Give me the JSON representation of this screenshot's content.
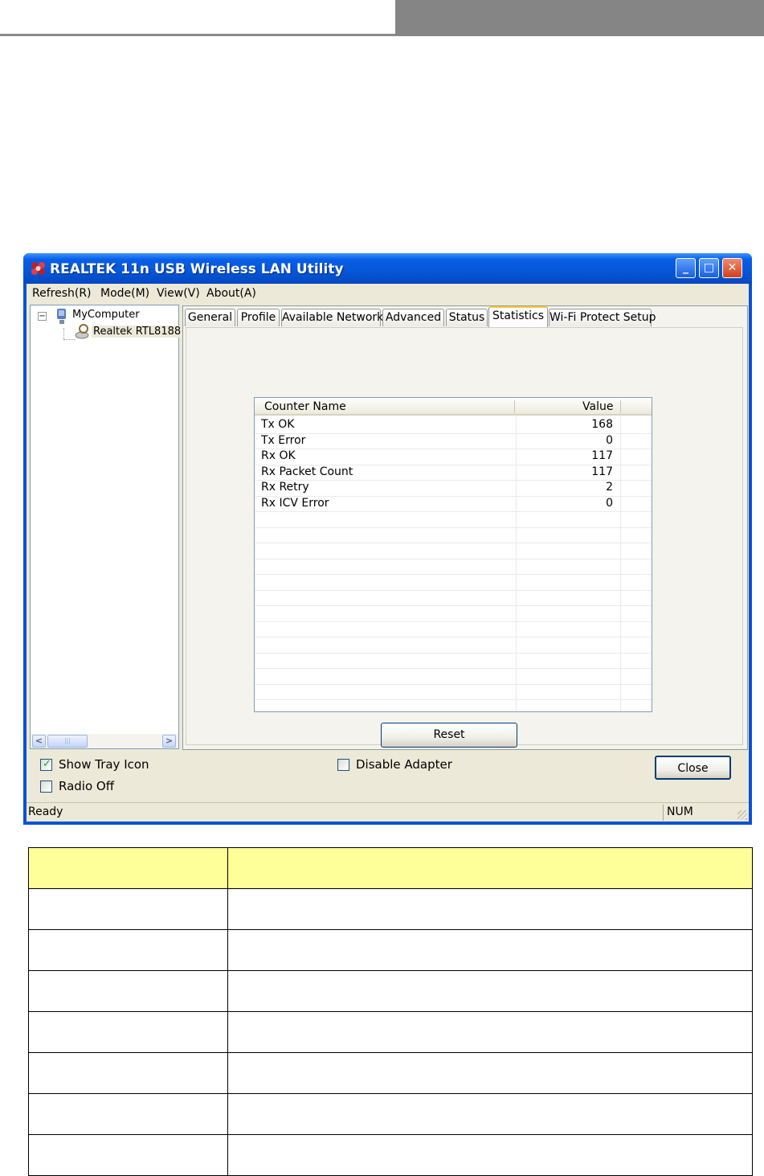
{
  "window": {
    "title": "REALTEK 11n USB Wireless LAN Utility",
    "buttons": [
      "minimize",
      "maximize",
      "close"
    ]
  },
  "menu": [
    "Refresh(R)",
    "Mode(M)",
    "View(V)",
    "About(A)"
  ],
  "tree": {
    "root": "MyComputer",
    "child": "Realtek RTL8188"
  },
  "tabs": [
    "General",
    "Profile",
    "Available Network",
    "Advanced",
    "Status",
    "Statistics",
    "Wi-Fi Protect Setup"
  ],
  "active_tab": "Statistics",
  "statistics": {
    "headers": {
      "name": "Counter Name",
      "value": "Value"
    },
    "rows": [
      {
        "name": "Tx OK",
        "value": "168"
      },
      {
        "name": "Tx Error",
        "value": "0"
      },
      {
        "name": "Rx OK",
        "value": "117"
      },
      {
        "name": "Rx Packet Count",
        "value": "117"
      },
      {
        "name": "Rx Retry",
        "value": "2"
      },
      {
        "name": "Rx ICV Error",
        "value": "0"
      }
    ],
    "reset_label": "Reset"
  },
  "options": {
    "show_tray_icon": {
      "label": "Show Tray Icon",
      "checked": true
    },
    "radio_off": {
      "label": "Radio Off",
      "checked": false
    },
    "disable_adapter": {
      "label": "Disable Adapter",
      "checked": false
    }
  },
  "close_label": "Close",
  "statusbar": {
    "text": "Ready",
    "num": "NUM"
  },
  "colors": {
    "title_blue": "#0a52d6",
    "table_header": "#ffff99",
    "dialog_bg": "#ece9d8"
  }
}
